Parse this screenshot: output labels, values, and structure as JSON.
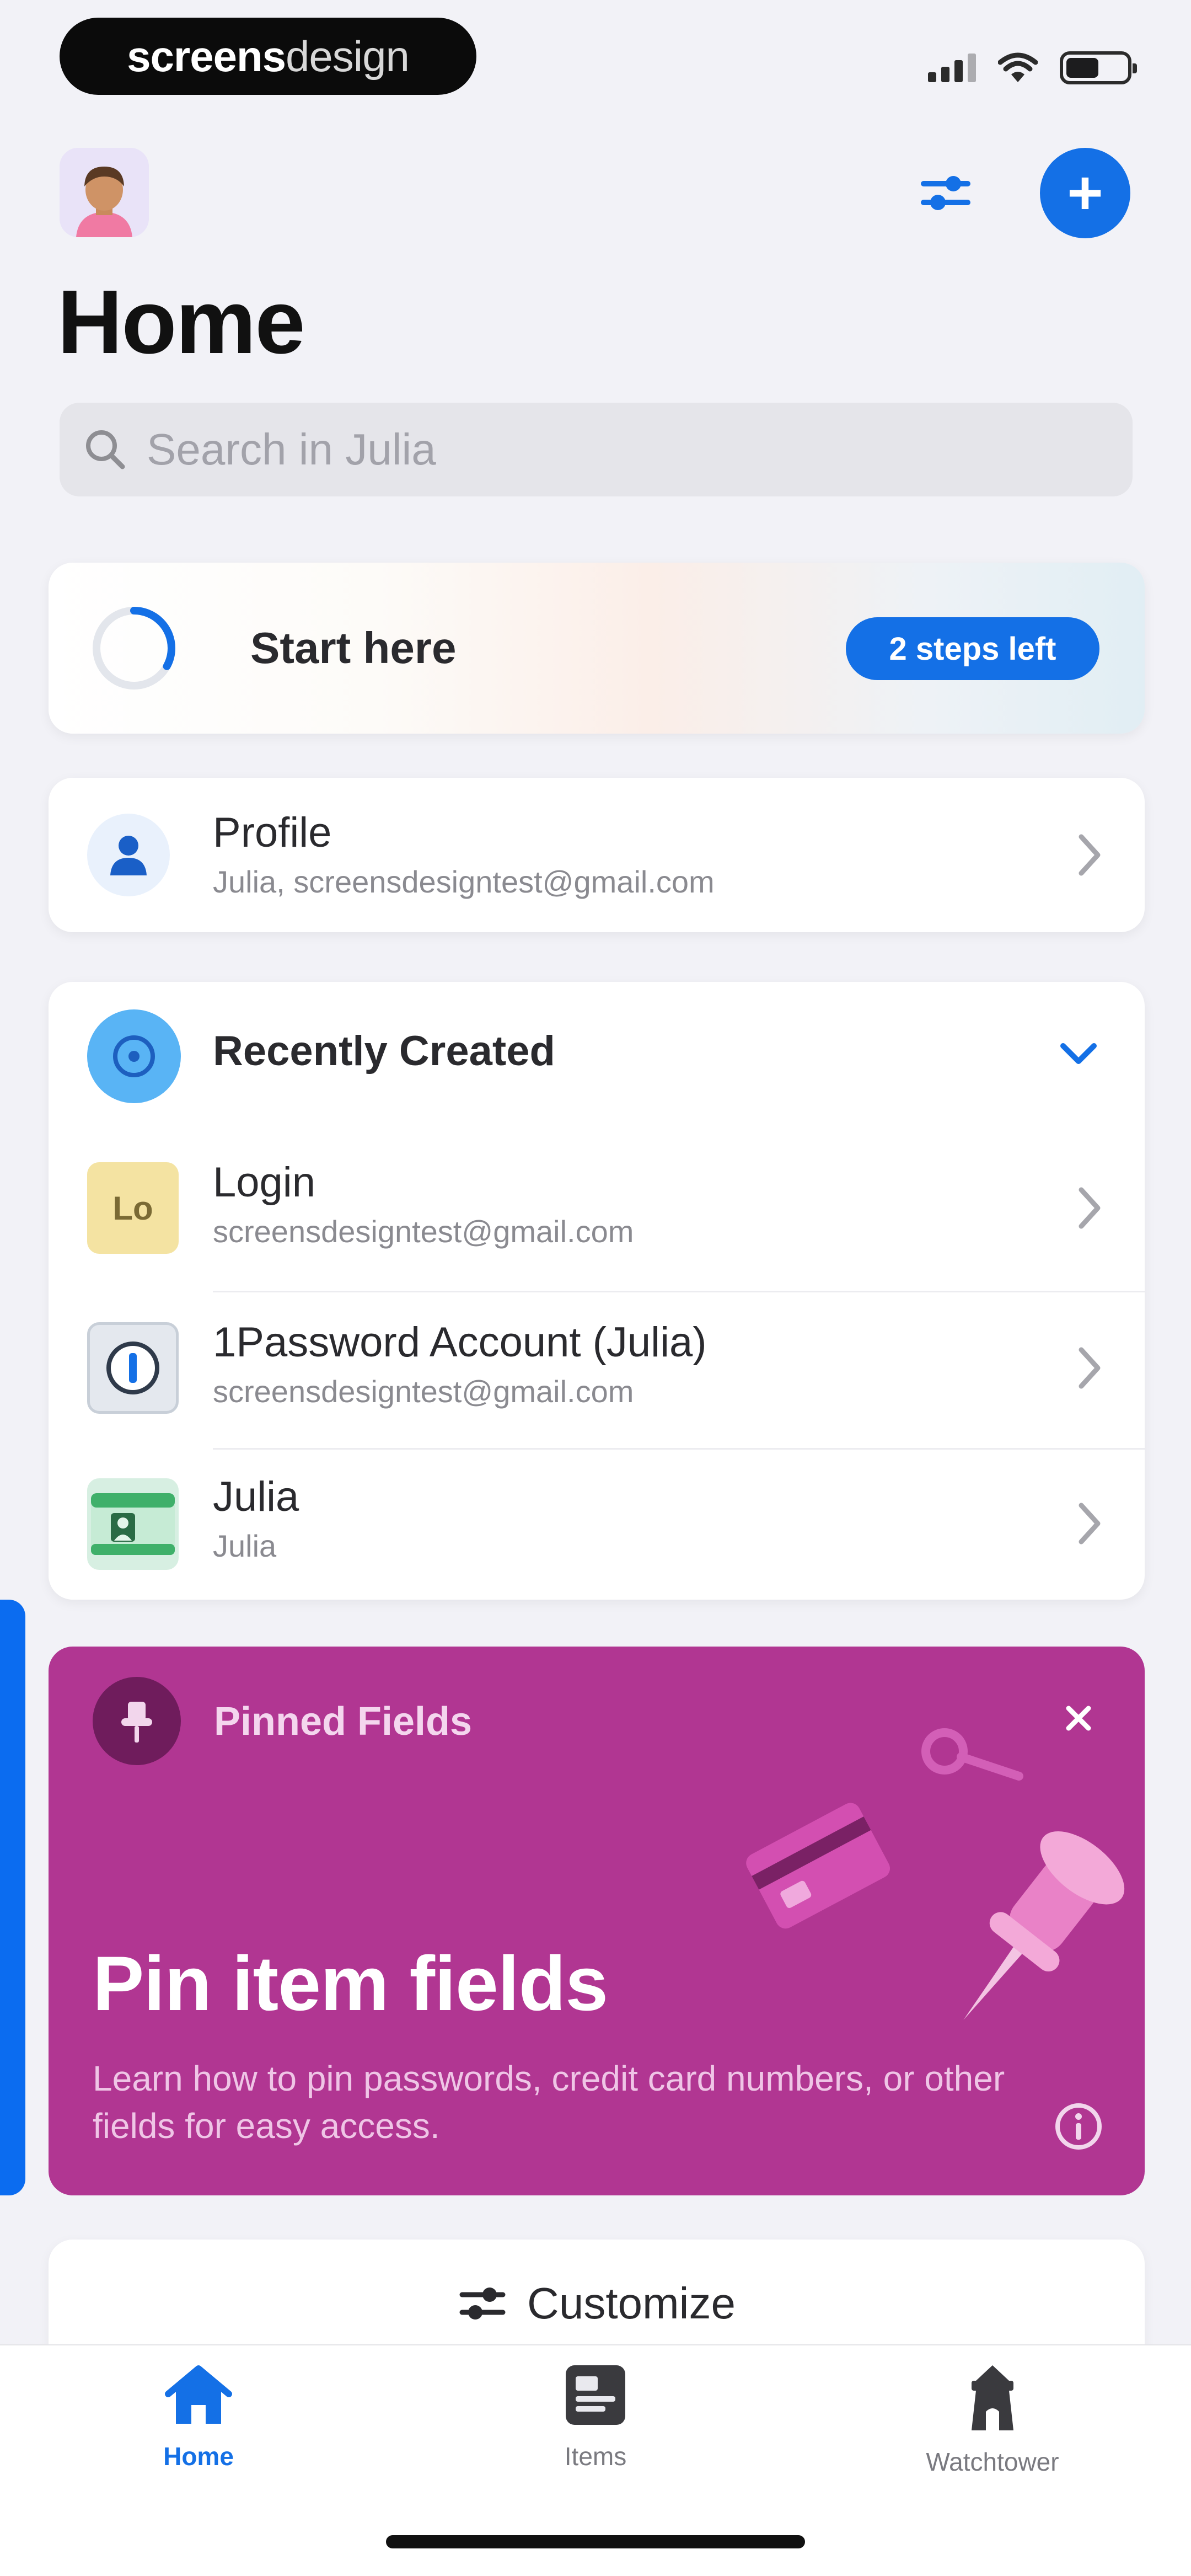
{
  "status_bar": {
    "brand_bold": "screens",
    "brand_light": "design",
    "signal_icon": "cellular-signal-icon",
    "wifi_icon": "wifi-icon",
    "battery_icon": "battery-icon",
    "battery_level": 0.55
  },
  "header": {
    "avatar_icon": "user-avatar",
    "filter_icon": "sliders-icon",
    "add_icon": "plus-icon",
    "add_label": "+",
    "title": "Home"
  },
  "search": {
    "placeholder": "Search in Julia",
    "value": "",
    "icon": "search-icon"
  },
  "start_here": {
    "label": "Start here",
    "steps_badge": "2 steps left",
    "progress": 0.33
  },
  "profile": {
    "title": "Profile",
    "subtitle": "Julia, screensdesigntest@gmail.com",
    "icon": "person-icon"
  },
  "recently_created": {
    "title": "Recently Created",
    "icon": "clock-icon",
    "items": [
      {
        "icon_text": "Lo",
        "title": "Login",
        "subtitle": "screensdesigntest@gmail.com",
        "icon": "login-icon"
      },
      {
        "icon_text": "",
        "title": "1Password Account (Julia)",
        "subtitle": "screensdesigntest@gmail.com",
        "icon": "1password-icon"
      },
      {
        "icon_text": "",
        "title": "Julia",
        "subtitle": "Julia",
        "icon": "identity-card-icon"
      }
    ]
  },
  "pinned_fields": {
    "label": "Pinned Fields",
    "headline": "Pin item fields",
    "description": "Learn how to pin passwords, credit card numbers, or other fields for easy access.",
    "close_icon": "close-icon",
    "info_icon": "info-icon",
    "colors": {
      "background": "#b13692",
      "badge": "#6f1c5c"
    }
  },
  "customize": {
    "label": "Customize",
    "icon": "sliders-icon"
  },
  "tab_bar": {
    "tabs": [
      {
        "label": "Home",
        "icon": "home-icon",
        "active": true
      },
      {
        "label": "Items",
        "icon": "items-icon",
        "active": false
      },
      {
        "label": "Watchtower",
        "icon": "watchtower-icon",
        "active": false
      }
    ]
  },
  "colors": {
    "accent": "#1470e6",
    "background": "#f2f2f7"
  }
}
